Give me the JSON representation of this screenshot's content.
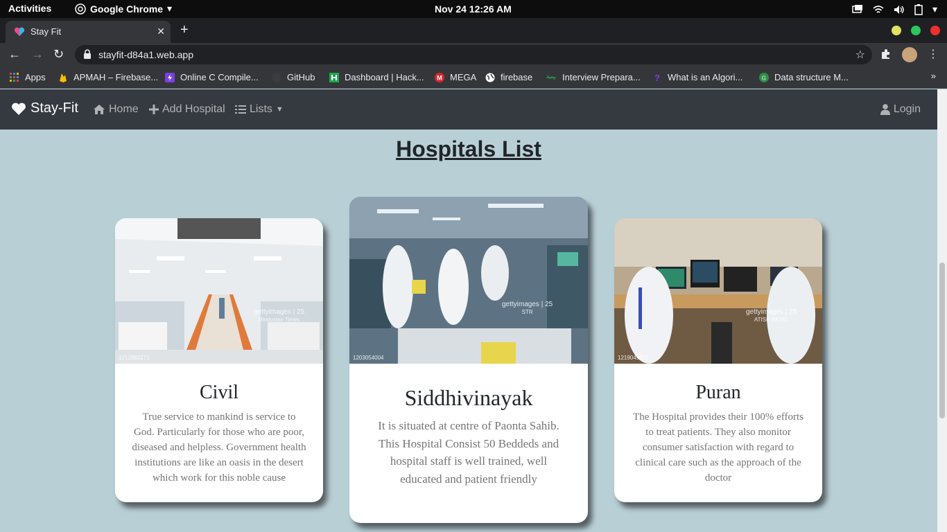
{
  "system": {
    "activities": "Activities",
    "app_name": "Google Chrome",
    "clock": "Nov 24  12:26 AM"
  },
  "browser": {
    "tab_title": "Stay Fit",
    "url": "stayfit-d84a1.web.app",
    "bookmarks": [
      {
        "label": "Apps",
        "color": "#ea4335"
      },
      {
        "label": "APMAH – Firebase...",
        "color": "#fbbc04"
      },
      {
        "label": "Online C Compile...",
        "color": "#7b3fe4"
      },
      {
        "label": "GitHub",
        "color": "#3c3c3c"
      },
      {
        "label": "Dashboard | Hack...",
        "color": "#2ec866"
      },
      {
        "label": "MEGA",
        "color": "#d9272e"
      },
      {
        "label": "firebase",
        "color": "#ffffff"
      },
      {
        "label": "Interview Prepara...",
        "color": "#2f8d46"
      },
      {
        "label": "What is an Algori...",
        "color": "#7b3fe4"
      },
      {
        "label": "Data structure M...",
        "color": "#2f8d46"
      }
    ]
  },
  "site": {
    "brand": "Stay-Fit",
    "nav": {
      "home": "Home",
      "add_hospital": "Add Hospital",
      "lists": "Lists",
      "login": "Login"
    },
    "title": "Hospitals List",
    "hospitals": [
      {
        "name": "Civil",
        "description": "True service to mankind is service to God. Particularly for those who are poor, diseased and helpless. Government health institutions are like an oasis in the desert which work for this noble cause",
        "photo_credit": "Hindustan Times",
        "photo_id": "1212882271"
      },
      {
        "name": "Siddhivinayak",
        "description": "It is situated at centre of Paonta Sahib. This Hospital Consist 50 Beddeds and hospital staff is well trained, well educated and patient friendly",
        "photo_credit": "STR",
        "photo_id": "1203054004"
      },
      {
        "name": "Puran",
        "description": "The Hospital provides their 100% efforts to treat patients. They also monitor consumer satisfaction with regard to clinical care such as the approach of the doctor",
        "photo_credit": "ATISH PATEL",
        "photo_id": "1219049622"
      }
    ],
    "watermark": "gettyimages",
    "watermark_badge": "25"
  }
}
